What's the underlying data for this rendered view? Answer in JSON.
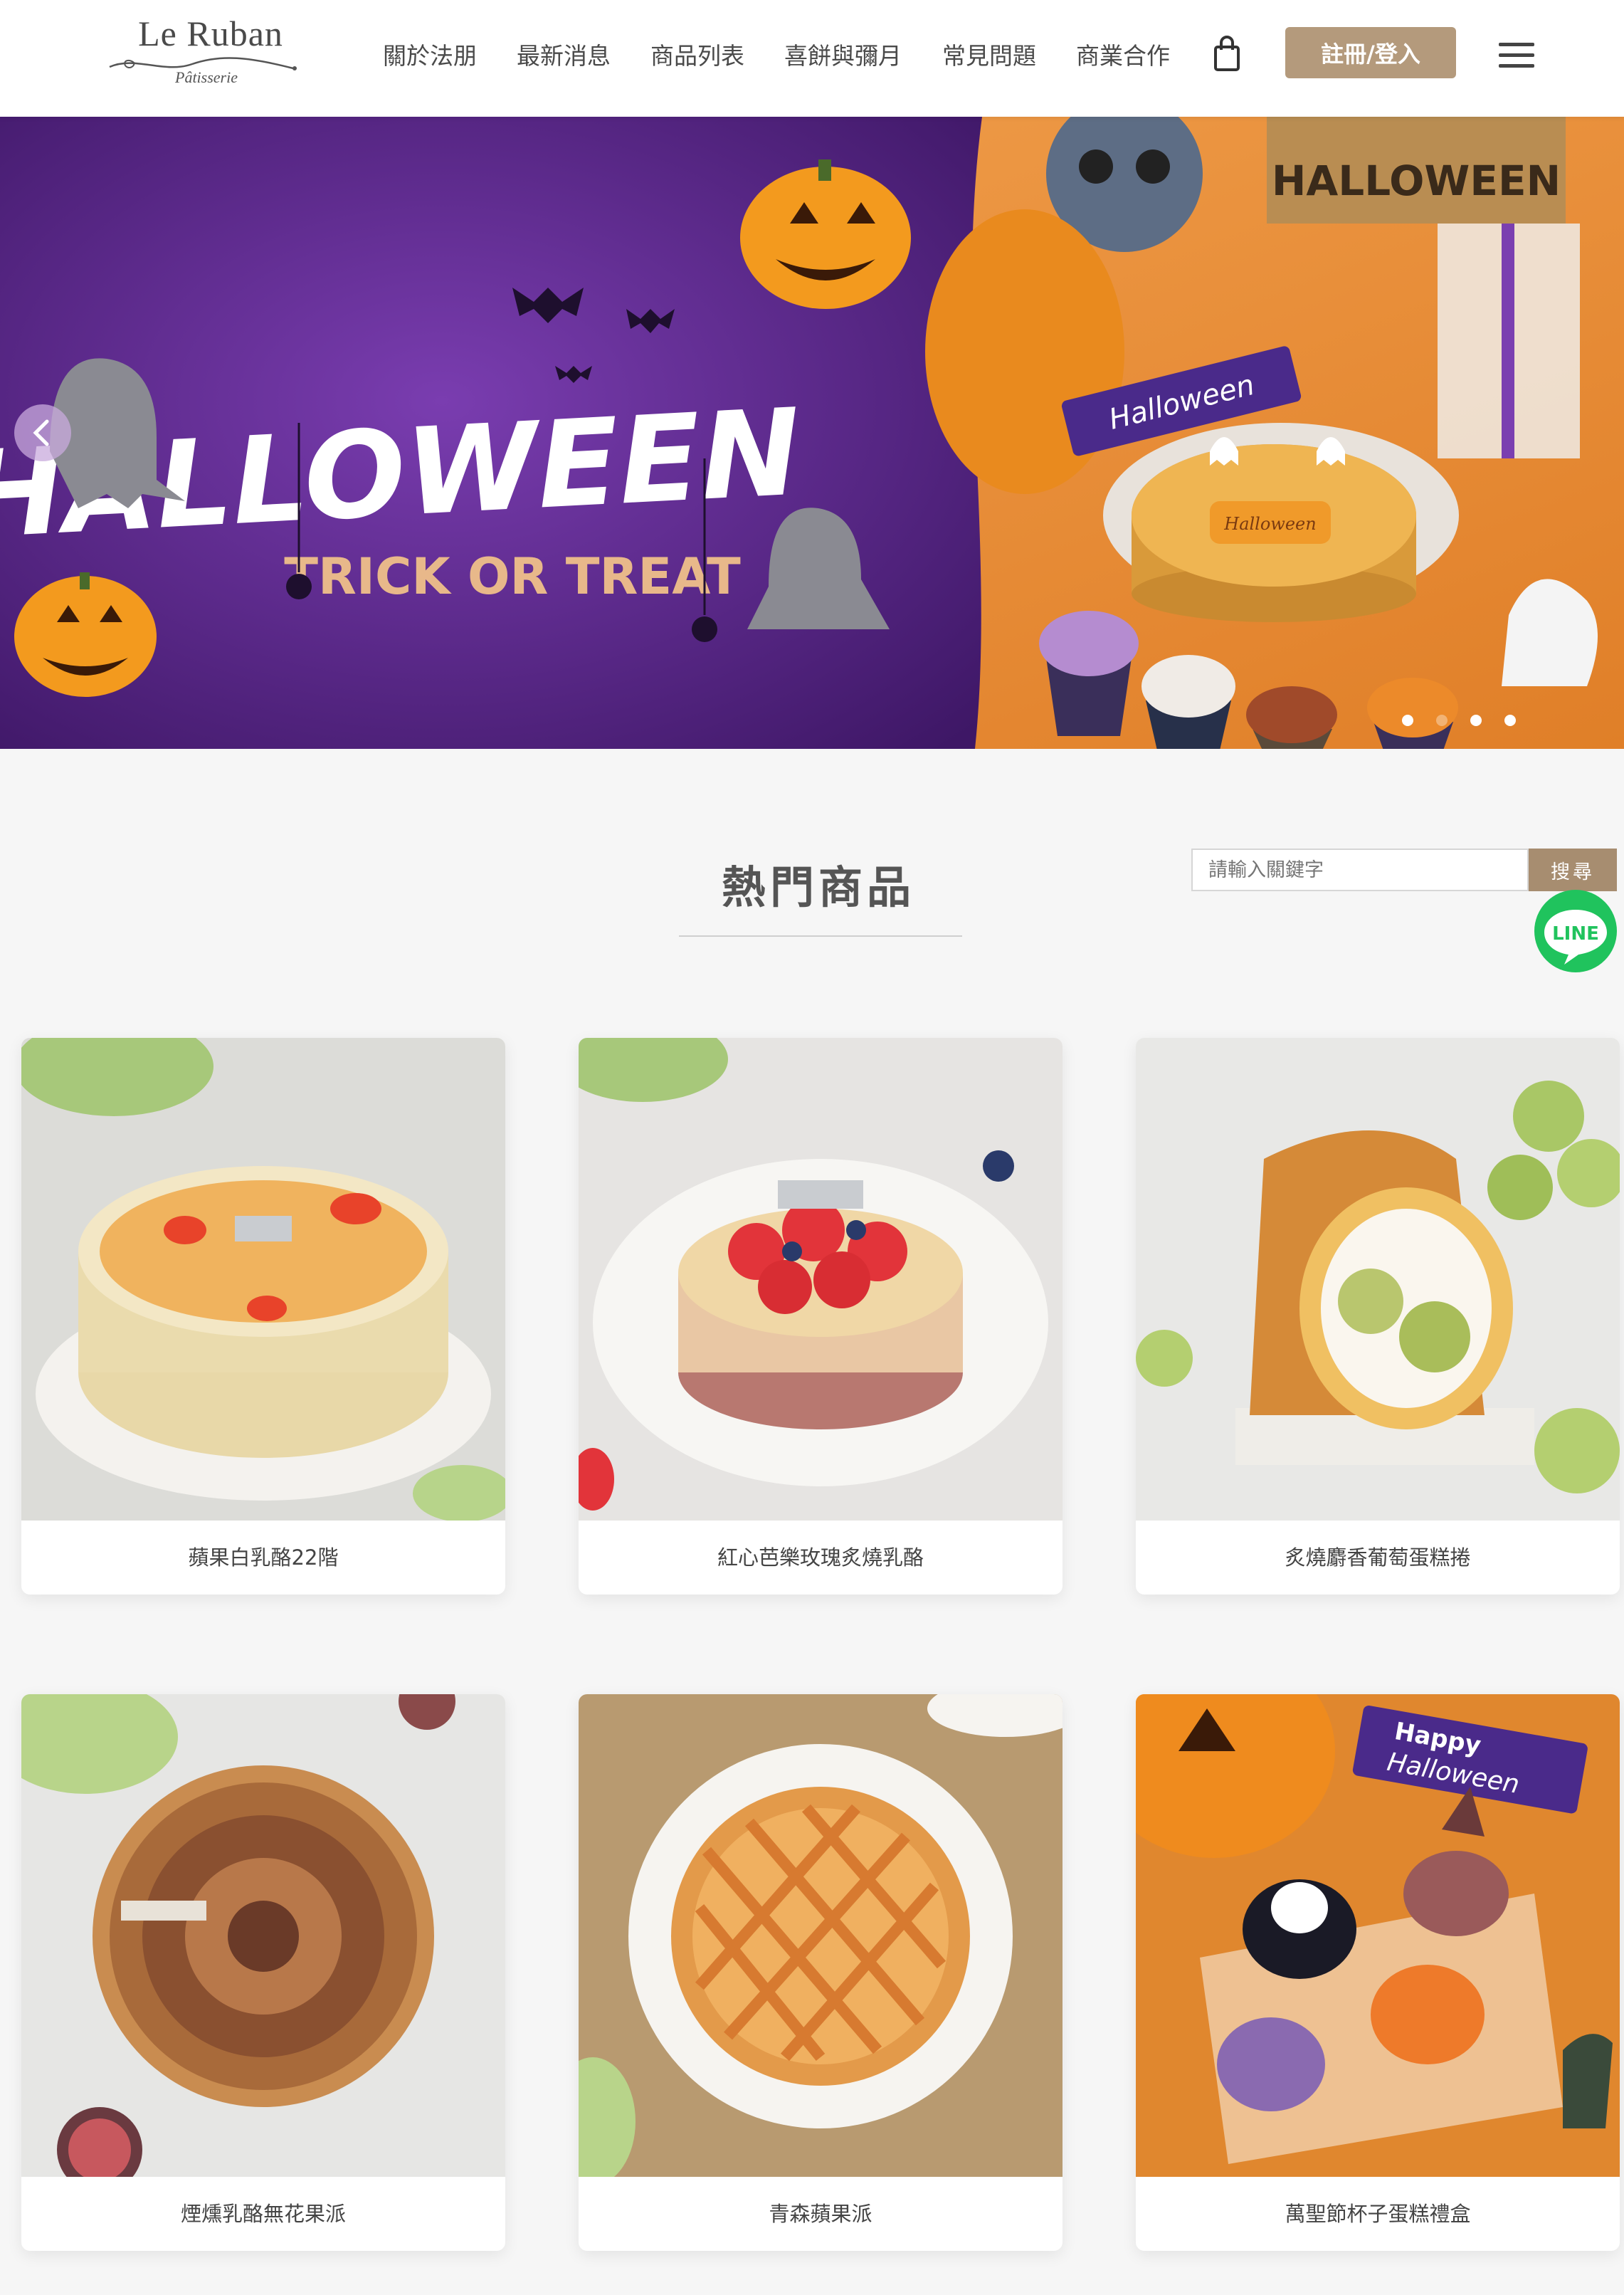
{
  "brand": {
    "name": "Le Ruban",
    "subtitle": "Pâtisserie"
  },
  "nav": {
    "items": [
      {
        "label": "關於法朋"
      },
      {
        "label": "最新消息"
      },
      {
        "label": "商品列表"
      },
      {
        "label": "喜餅與彌月"
      },
      {
        "label": "常見問題"
      },
      {
        "label": "商業合作"
      }
    ],
    "cart_icon": "shopping-bag-icon",
    "login_label": "註冊/登入",
    "menu_icon": "hamburger-menu-icon"
  },
  "hero": {
    "title": "HALLOWEEN",
    "subtitle": "TRICK OR TREAT",
    "sign_top": "HALLOWEEN",
    "banner_text": "Halloween",
    "cake_label": "Halloween",
    "slide_count": 4,
    "active_slide": 1,
    "colors": {
      "purple": "#5b2a8c",
      "orange": "#e6892f",
      "accent": "#b49a7c"
    }
  },
  "section": {
    "title": "熱門商品"
  },
  "search": {
    "placeholder": "請輸入關鍵字",
    "button_label": "搜尋"
  },
  "line": {
    "label": "LINE",
    "color": "#20c35d"
  },
  "products": [
    {
      "name": "蘋果白乳酪22階"
    },
    {
      "name": "紅心芭樂玫瑰炙燒乳酪"
    },
    {
      "name": "炙燒麝香葡萄蛋糕捲"
    },
    {
      "name": "煙燻乳酪無花果派"
    },
    {
      "name": "青森蘋果派"
    },
    {
      "name": "萬聖節杯子蛋糕禮盒"
    }
  ],
  "product_banner": {
    "line1": "Happy",
    "line2": "Halloween"
  }
}
